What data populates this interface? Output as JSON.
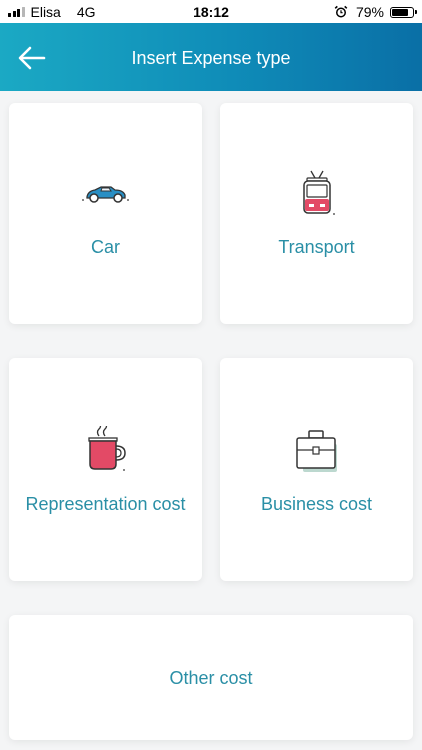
{
  "status_bar": {
    "carrier": "Elisa",
    "network": "4G",
    "time": "18:12",
    "battery_percent": "79%",
    "battery_level": 0.79,
    "alarm_icon": "alarm-clock-icon"
  },
  "header": {
    "title": "Insert Expense type",
    "back_icon": "arrow-left-icon"
  },
  "expense_types": {
    "car": {
      "label": "Car",
      "icon": "car-icon"
    },
    "transport": {
      "label": "Transport",
      "icon": "trolleybus-icon"
    },
    "representation": {
      "label": "Representation cost",
      "icon": "coffee-cup-icon"
    },
    "business": {
      "label": "Business cost",
      "icon": "briefcase-icon"
    },
    "other": {
      "label": "Other cost"
    }
  },
  "colors": {
    "header_gradient_start": "#1ba9c4",
    "header_gradient_end": "#0a6fa6",
    "label_text": "#2a8fa6",
    "background": "#f4f5f6"
  }
}
